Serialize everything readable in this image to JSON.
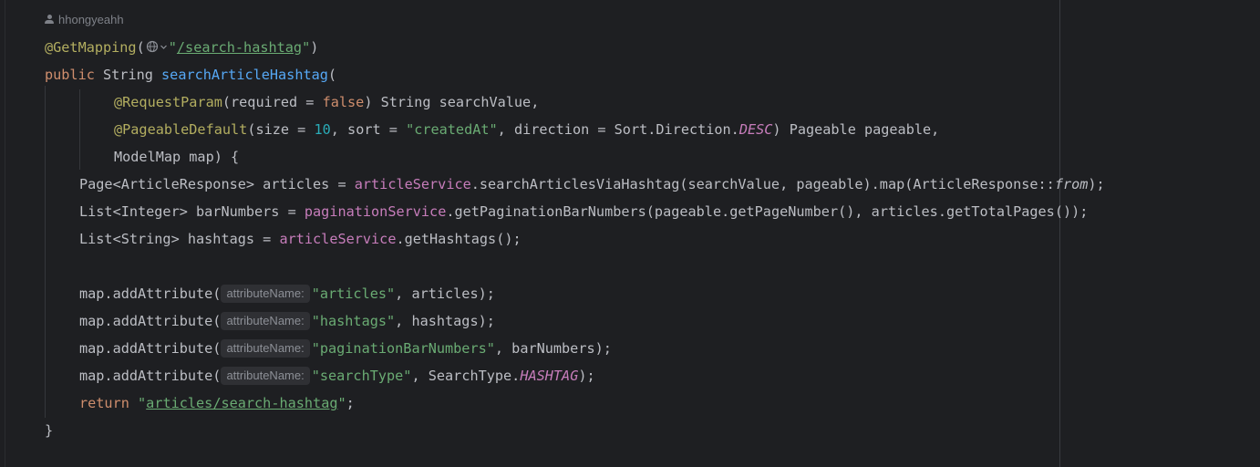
{
  "author": "hhongyeahh",
  "code": {
    "annotation_getmapping": "@GetMapping",
    "open_paren": "(",
    "mapping_quote_open": "\"",
    "mapping_path": "/search-hashtag",
    "mapping_quote_close": "\"",
    "close_paren": ")",
    "kw_public": "public",
    "type_string": " String ",
    "method_name": "searchArticleHashtag",
    "method_open": "(",
    "ann_requestparam": "@RequestParam",
    "requestparam_args_1": "(required = ",
    "kw_false": "false",
    "requestparam_args_2": ") String searchValue,",
    "ann_pageabledefault": "@PageableDefault",
    "pd_1": "(size = ",
    "pd_size": "10",
    "pd_2": ", sort = ",
    "pd_sort": "\"createdAt\"",
    "pd_3": ", direction = Sort.Direction.",
    "pd_desc": "DESC",
    "pd_4": ") Pageable pageable,",
    "modelmap_line": "ModelMap map) {",
    "l1_a": "Page<ArticleResponse> articles = ",
    "l1_field": "articleService",
    "l1_b": ".searchArticlesViaHashtag(searchValue, pageable).map(ArticleResponse::",
    "l1_from": "from",
    "l1_c": ");",
    "l2_a": "List<Integer> barNumbers = ",
    "l2_field": "paginationService",
    "l2_b": ".getPaginationBarNumbers(pageable.getPageNumber(), articles.getTotalPages());",
    "l3_a": "List<String> hashtags = ",
    "l3_field": "articleService",
    "l3_b": ".getHashtags();",
    "add_call": "map.addAttribute(",
    "hint_label": "attributeName:",
    "add1_str": "\"articles\"",
    "add1_rest": ", articles);",
    "add2_str": "\"hashtags\"",
    "add2_rest": ", hashtags);",
    "add3_str": "\"paginationBarNumbers\"",
    "add3_rest": ", barNumbers);",
    "add4_str": "\"searchType\"",
    "add4_mid": ", SearchType.",
    "add4_const": "HASHTAG",
    "add4_rest": ");",
    "kw_return": "return",
    "return_quote_open": " \"",
    "return_path": "articles/search-hashtag",
    "return_quote_close": "\"",
    "return_end": ";",
    "close_brace": "}"
  },
  "colors": {
    "background": "#1e1f22",
    "annotation": "#b3ae60",
    "keyword": "#cf8e6d",
    "method": "#56a8f5",
    "string": "#6aab73",
    "number": "#2aacb8",
    "field": "#c77dbb",
    "text": "#bcbec4"
  },
  "icons": [
    "person-icon",
    "globe-icon",
    "chevron-down-icon"
  ]
}
